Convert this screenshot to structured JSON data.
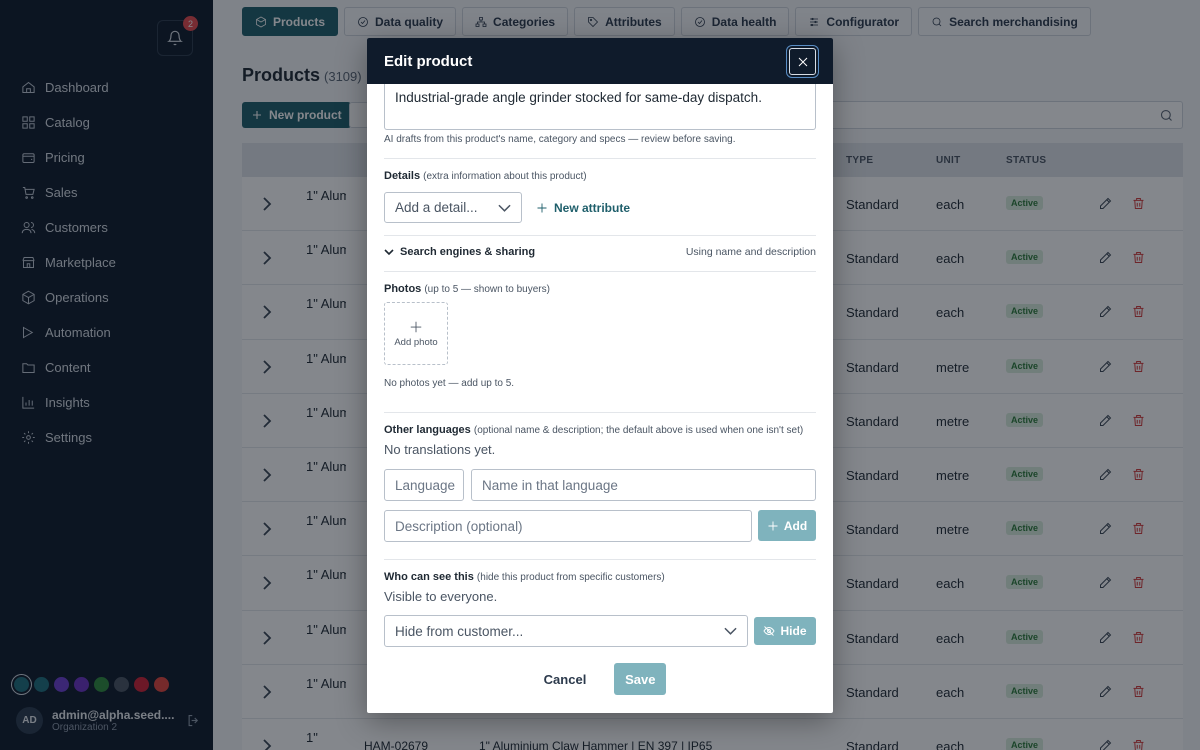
{
  "sidebar": {
    "notifications_count": "2",
    "items": [
      {
        "label": "Dashboard",
        "icon": "home-icon"
      },
      {
        "label": "Catalog",
        "icon": "grid-icon"
      },
      {
        "label": "Pricing",
        "icon": "wallet-icon"
      },
      {
        "label": "Sales",
        "icon": "cart-icon"
      },
      {
        "label": "Customers",
        "icon": "users-icon"
      },
      {
        "label": "Marketplace",
        "icon": "store-icon"
      },
      {
        "label": "Operations",
        "icon": "box-icon"
      },
      {
        "label": "Automation",
        "icon": "bolt-icon"
      },
      {
        "label": "Content",
        "icon": "folder-icon"
      },
      {
        "label": "Insights",
        "icon": "chart-icon"
      },
      {
        "label": "Settings",
        "icon": "gear-icon"
      }
    ],
    "theme_colors": [
      "#1f6f7d",
      "#1f6f7d",
      "#6d3fd1",
      "#6b32c2",
      "#2f8a3d",
      "#4a5563",
      "#cf2035",
      "#e2453d"
    ],
    "user": {
      "initials": "AD",
      "email": "admin@alpha.seed....",
      "org": "Organization 2"
    }
  },
  "tabs": [
    "Products",
    "Data quality",
    "Categories",
    "Attributes",
    "Data health",
    "Configurator",
    "Search merchandising"
  ],
  "page": {
    "title": "Products",
    "count": "(3109)",
    "new_button": "New product"
  },
  "table": {
    "headers": {
      "type": "TYPE",
      "unit": "UNIT",
      "status": "STATUS"
    },
    "rows": [
      {
        "img": "1\" Alum",
        "type": "Standard",
        "unit": "each",
        "status": "Active"
      },
      {
        "img": "1\" Alum",
        "type": "Standard",
        "unit": "each",
        "status": "Active"
      },
      {
        "img": "1\" Alum",
        "type": "Standard",
        "unit": "each",
        "status": "Active"
      },
      {
        "img": "1\" Alum",
        "type": "Standard",
        "unit": "metre",
        "status": "Active"
      },
      {
        "img": "1\" Alum",
        "type": "Standard",
        "unit": "metre",
        "status": "Active"
      },
      {
        "img": "1\" Alum",
        "type": "Standard",
        "unit": "metre",
        "status": "Active"
      },
      {
        "img": "1\" Alum",
        "type": "Standard",
        "unit": "metre",
        "status": "Active"
      },
      {
        "img": "1\" Alum",
        "type": "Standard",
        "unit": "each",
        "status": "Active"
      },
      {
        "img": "1\" Alum",
        "type": "Standard",
        "unit": "each",
        "status": "Active"
      },
      {
        "img": "1\" Alum",
        "type": "Standard",
        "unit": "each",
        "status": "Active"
      },
      {
        "img": "1\"",
        "sku": "HAM-02679",
        "name": "1\" Aluminium Claw Hammer | EN 397 | IP65",
        "type": "Standard",
        "unit": "each",
        "status": "Active"
      }
    ]
  },
  "modal": {
    "title": "Edit product",
    "description_text": "Industrial-grade angle grinder stocked for same-day dispatch.",
    "ai_hint": "AI drafts from this product's name, category and specs — review before saving.",
    "details_label": "Details",
    "details_hint": "(extra information about this product)",
    "details_placeholder": "Add a detail...",
    "new_attribute": "New attribute",
    "seo_label": "Search engines & sharing",
    "seo_note": "Using name and description",
    "photos_label": "Photos",
    "photos_hint": "(up to 5 — shown to buyers)",
    "add_photo": "Add photo",
    "photos_empty": "No photos yet — add up to 5.",
    "languages_label": "Other languages",
    "languages_hint": "(optional name & description; the default above is used when one isn't set)",
    "languages_empty": "No translations yet.",
    "language_placeholder": "Language",
    "name_placeholder": "Name in that language",
    "desc_placeholder": "Description (optional)",
    "add_label": "Add",
    "visibility_label": "Who can see this",
    "visibility_hint": "(hide this product from specific customers)",
    "visibility_status": "Visible to everyone.",
    "hide_placeholder": "Hide from customer...",
    "hide_label": "Hide",
    "cancel": "Cancel",
    "save": "Save"
  }
}
